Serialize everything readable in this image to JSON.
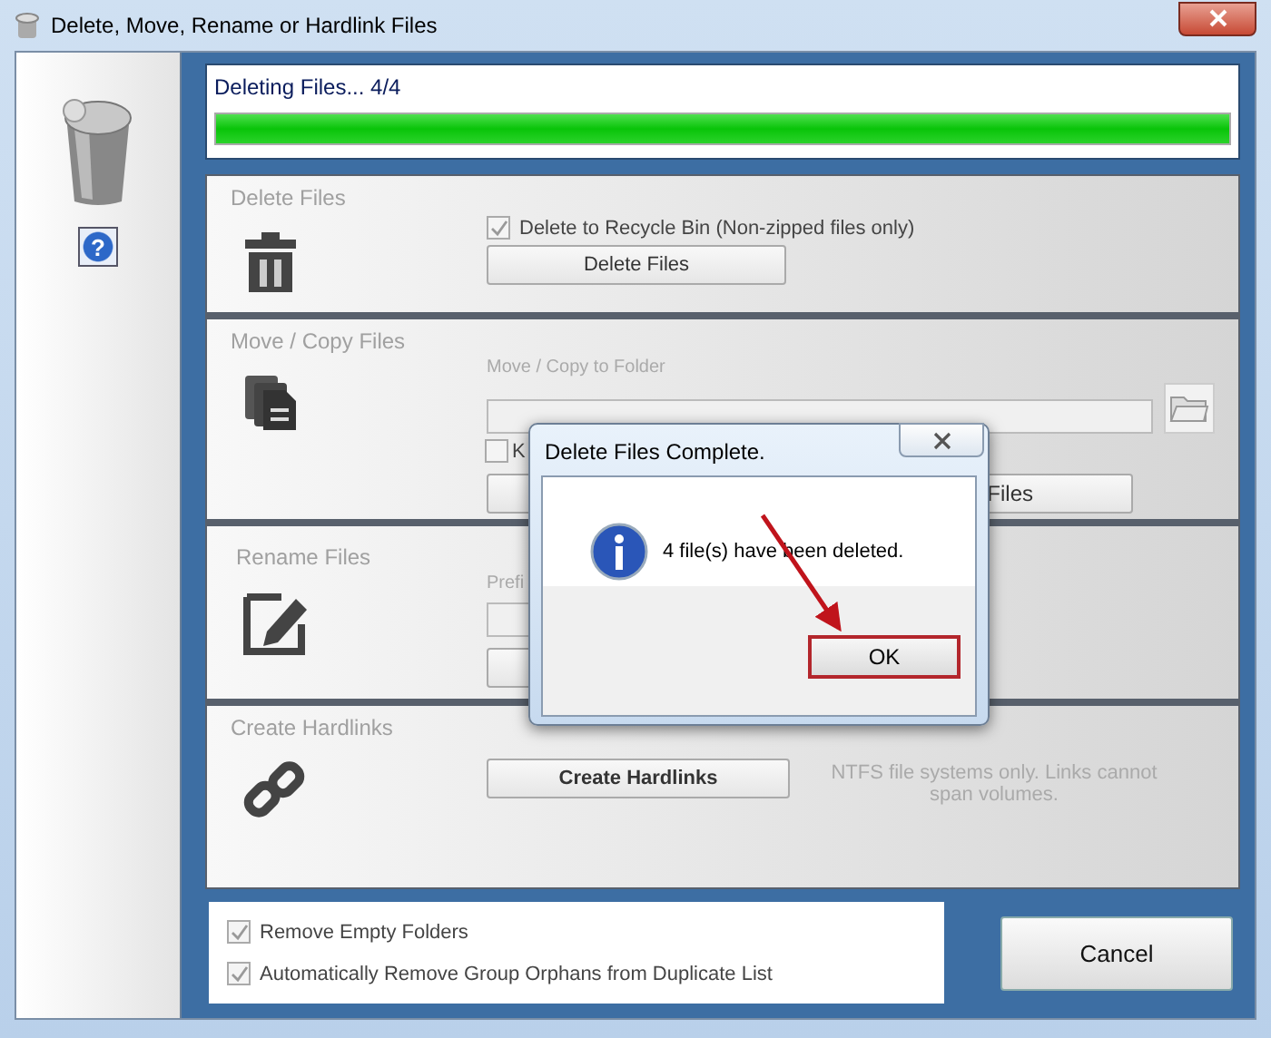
{
  "window": {
    "title": "Delete, Move, Rename or Hardlink Files"
  },
  "sidebar": {
    "help_button": "?"
  },
  "progress": {
    "label": "Deleting Files... 4/4",
    "level": 1
  },
  "sections": [
    {
      "kind": "delete",
      "title": "Delete Files",
      "checkbox": {
        "label": "Delete to Recycle Bin (Non-zipped files only)",
        "checked": true
      },
      "button": "Delete Files"
    },
    {
      "kind": "move",
      "title": "Move / Copy Files",
      "folder_label": "Move / Copy to Folder",
      "checkbox": {
        "label": "K",
        "checked": false
      },
      "button": "Files"
    },
    {
      "kind": "rename",
      "title": "Rename Files",
      "prefix_label": "Prefi"
    },
    {
      "kind": "hardlink",
      "title": "Create Hardlinks",
      "button": "Create Hardlinks",
      "note": "NTFS file systems only.  Links cannot span volumes."
    }
  ],
  "options": [
    {
      "label": "Remove Empty Folders",
      "checked": true
    },
    {
      "label": "Automatically Remove Group Orphans from Duplicate List",
      "checked": true
    }
  ],
  "cancel_button": "Cancel",
  "dialog": {
    "title": "Delete Files Complete.",
    "message": "4 file(s) have been deleted.",
    "ok_button": "OK"
  }
}
